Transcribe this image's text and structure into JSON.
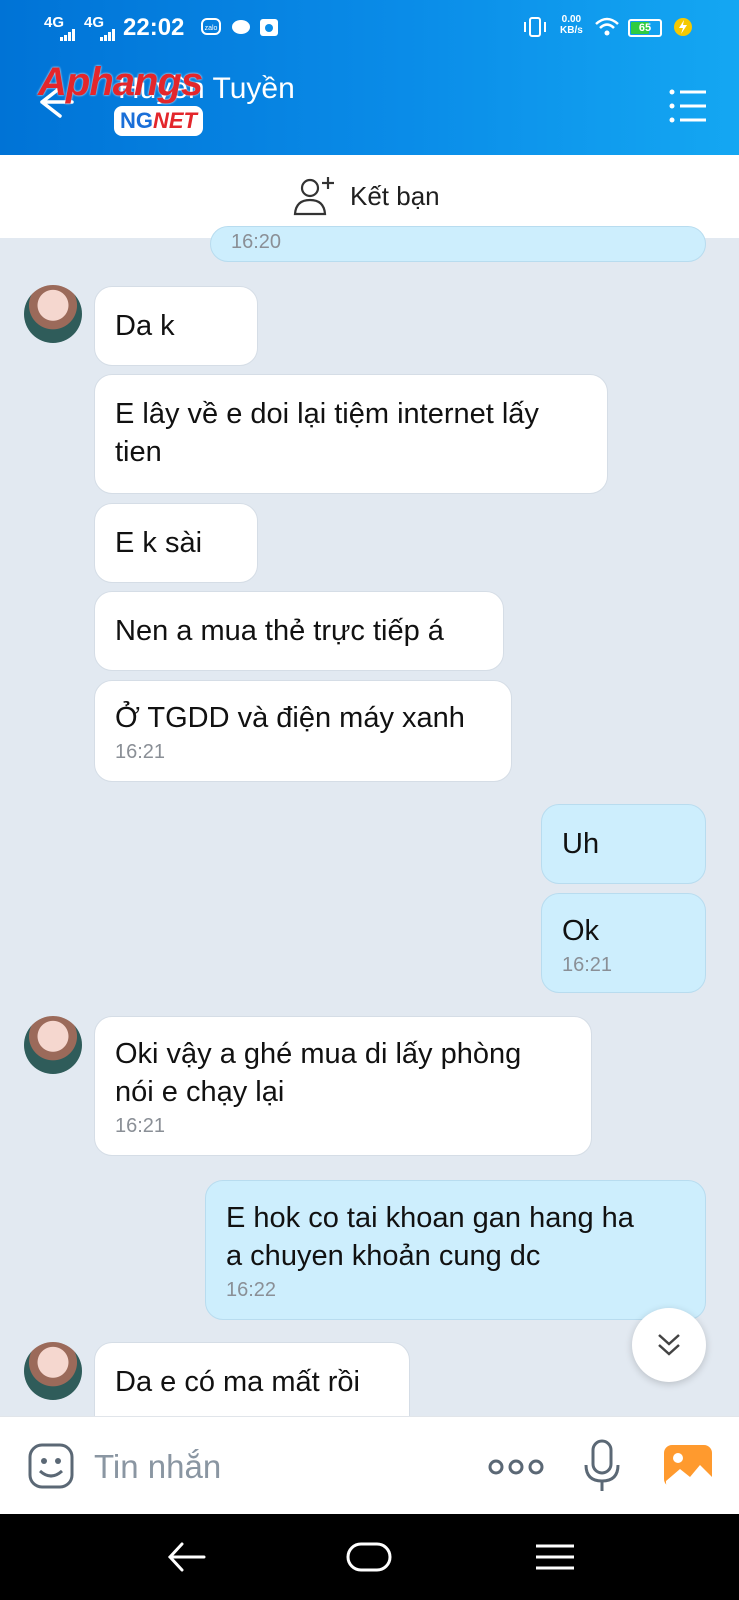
{
  "status_bar": {
    "signal1": "4G",
    "signal2": "4G",
    "time": "22:02",
    "speed_value": "0.00",
    "speed_unit": "KB/s",
    "battery": "65",
    "battery_level": 0.65
  },
  "header": {
    "title": "Huyền Tuyền",
    "watermark_top": "Aphangs",
    "watermark_badge_left": "NG",
    "watermark_badge_right": "NET"
  },
  "add_friend": {
    "label": "Kết bạn"
  },
  "messages": [
    {
      "side": "me",
      "text": "",
      "time": "16:20"
    },
    {
      "side": "them",
      "text": "Da k",
      "time": ""
    },
    {
      "side": "them",
      "text": "E lây về e doi lại tiệm internet lấy\ntien",
      "time": ""
    },
    {
      "side": "them",
      "text": "E k sài",
      "time": ""
    },
    {
      "side": "them",
      "text": "Nen a mua thẻ trực tiếp á",
      "time": ""
    },
    {
      "side": "them",
      "text": "Ở TGDD và điện máy xanh",
      "time": "16:21"
    },
    {
      "side": "me",
      "text": "Uh",
      "time": ""
    },
    {
      "side": "me",
      "text": "Ok",
      "time": "16:21"
    },
    {
      "side": "them",
      "text": "Oki vậy a ghé mua di lấy phòng\nnói e chạy lại",
      "time": "16:21"
    },
    {
      "side": "me",
      "text": "E hok co tai khoan gan hang ha\na chuyen khoản cung dc",
      "time": "16:22"
    },
    {
      "side": "them",
      "text": "Da e có ma mất rồi",
      "time": ""
    }
  ],
  "composer": {
    "placeholder": "Tin nhắn"
  },
  "colors": {
    "header_start": "#0073d6",
    "header_end": "#14a7f2",
    "chat_bg": "#e2e9f1",
    "my_bubble": "#cdeefd",
    "their_bubble": "#ffffff",
    "photo_icon": "#ff9a2e"
  },
  "icons": {
    "back": "arrow-left-icon",
    "menu": "list-menu-icon",
    "add_friend": "user-plus-icon",
    "emoji": "emoji-icon",
    "more": "more-dots-icon",
    "mic": "microphone-icon",
    "photo": "photo-icon",
    "scroll_down": "double-chevron-down-icon"
  }
}
